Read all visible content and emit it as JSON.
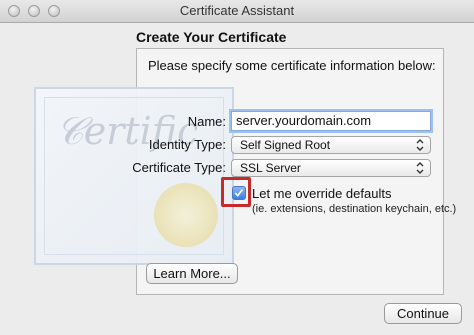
{
  "window": {
    "title": "Certificate Assistant"
  },
  "page": {
    "heading": "Create Your Certificate",
    "instruction": "Please specify some certificate information below:"
  },
  "form": {
    "name_label": "Name:",
    "name_value": "server.yourdomain.com",
    "identity_label": "Identity Type:",
    "identity_value": "Self Signed Root",
    "cert_type_label": "Certificate Type:",
    "cert_type_value": "SSL Server",
    "override_label": "Let me override defaults",
    "override_checked": true,
    "override_note": "(ie. extensions, destination keychain, etc.)"
  },
  "buttons": {
    "learn_more": "Learn More...",
    "continue": "Continue"
  },
  "colors": {
    "highlight": "#c62b2b",
    "focus_ring": "#9ec1f0",
    "checkbox": "#3a7de0"
  }
}
